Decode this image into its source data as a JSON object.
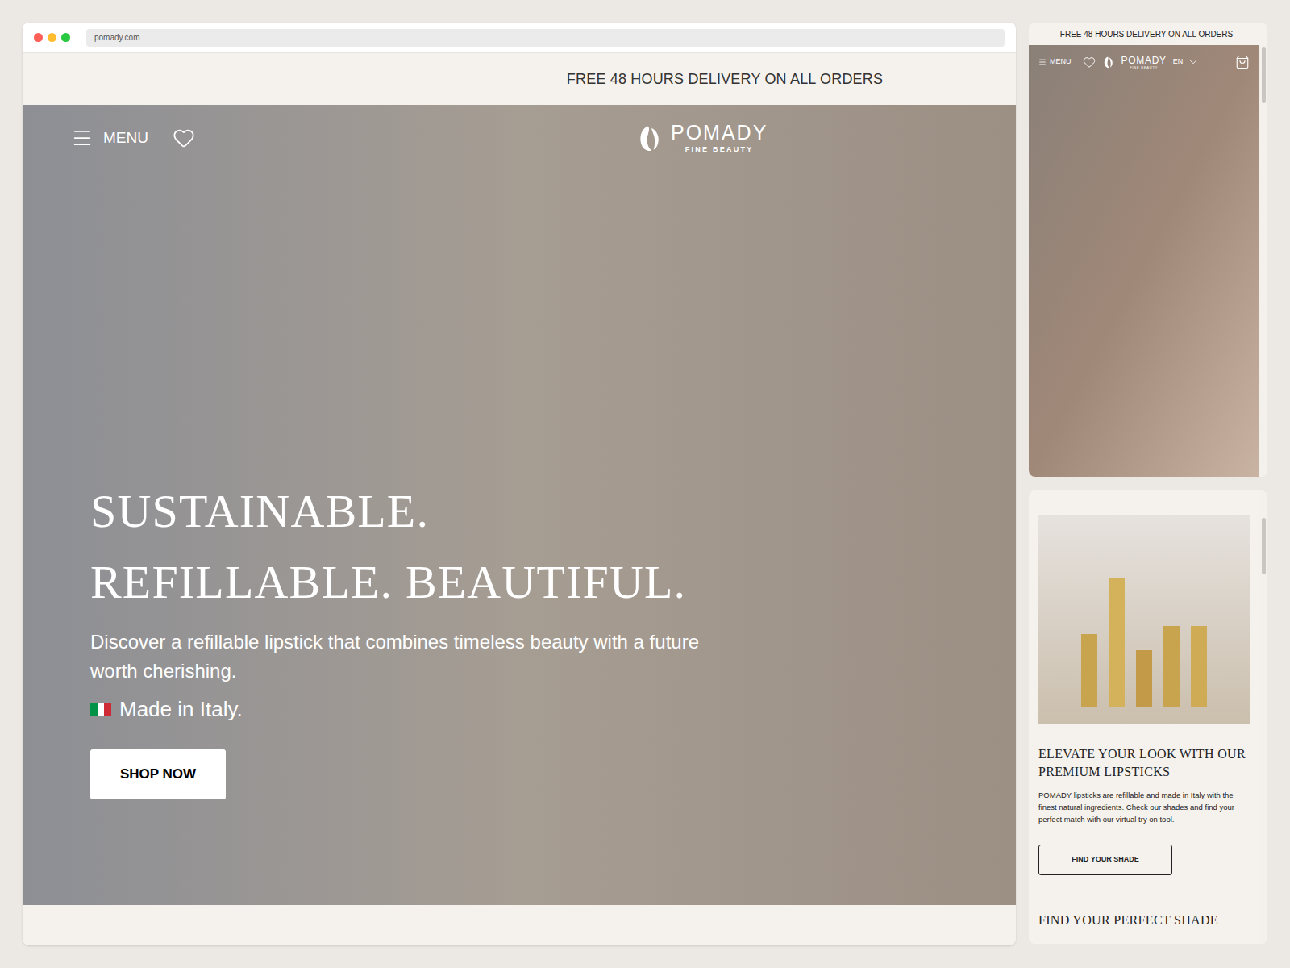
{
  "browser": {
    "url": "pomady.com",
    "dots": [
      {
        "color": "#ff5f57"
      },
      {
        "color": "#febc2e"
      },
      {
        "color": "#28c840"
      }
    ]
  },
  "announcement": "FREE 48 HOURS DELIVERY ON ALL ORDERS",
  "nav": {
    "menu": "MENU",
    "logo": {
      "name": "POMADY",
      "tagline": "FINE BEAUTY"
    }
  },
  "hero": {
    "headline": [
      "SUSTAINABLE.",
      "REFILLABLE. BEAUTIFUL."
    ],
    "subtitle": "Discover a refillable lipstick that combines timeless beauty with a future worth cherishing.",
    "origin": "Made in Italy.",
    "cta": "SHOP NOW"
  },
  "mobile_top": {
    "announcement": "FREE 48 HOURS DELIVERY ON ALL ORDERS",
    "menu": "MENU",
    "logo": {
      "name": "POMADY",
      "tagline": "FINE BEAUTY"
    },
    "language": "EN"
  },
  "mobile_bottom": {
    "heading": "ELEVATE YOUR LOOK WITH OUR PREMIUM LIPSTICKS",
    "body": "POMADY lipsticks are refillable and made in Italy with the finest natural ingredients. Check our shades and find your perfect match with our virtual try on tool.",
    "cta": "FIND YOUR SHADE",
    "next_heading": "FIND YOUR PERFECT SHADE"
  }
}
